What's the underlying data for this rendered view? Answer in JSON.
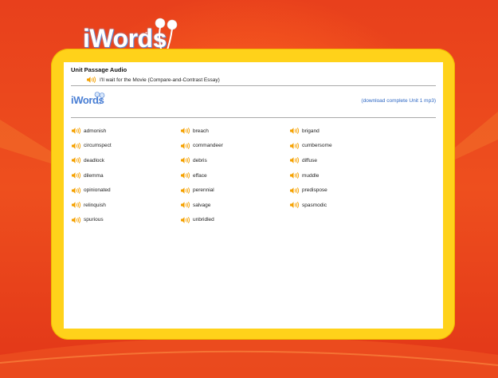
{
  "app": {
    "logo_text": "iWords",
    "logo_tm": "TM"
  },
  "colors": {
    "background": "#e63a1c",
    "frame": "#ffd21a",
    "panel": "#ffffff",
    "link": "#2e68c4",
    "speaker": "#f5a100"
  },
  "passage": {
    "heading": "Unit Passage Audio",
    "title": "I'll wait for the Movie (Compare-and-Contrast Essay)"
  },
  "panel_logo": {
    "text": "iWords"
  },
  "download": {
    "label": "(download complete Unit 1 mp3)"
  },
  "words": [
    "admonish",
    "breach",
    "brigand",
    "circumspect",
    "commandeer",
    "cumbersome",
    "deadlock",
    "debris",
    "diffuse",
    "dilemma",
    "efface",
    "muddle",
    "opinionated",
    "perennial",
    "predispose",
    "relinquish",
    "salvage",
    "spasmodic",
    "spurious",
    "unbridled"
  ],
  "icons": {
    "speaker": "speaker-icon",
    "earbuds": "earbuds-icon"
  }
}
